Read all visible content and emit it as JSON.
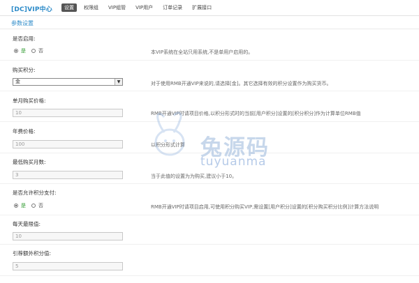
{
  "brand": "[DC]VIP中心",
  "nav": [
    "设置",
    "权限组",
    "VIP组管",
    "VIP用户",
    "订单记录",
    "扩展接口"
  ],
  "section_title": "参数设置",
  "fields": {
    "enable": {
      "label": "是否启用:",
      "opt_yes": "是",
      "opt_no": "否",
      "hint": "本VIP系统在全站只用系统,不是单用户启用的。"
    },
    "currency": {
      "label": "购买积分:",
      "value": "金",
      "hint": "对于使用RMB开通VIP来说的,请选择[金]。其它选择有效的积分设置作为购买货币。"
    },
    "monthly_price": {
      "label": "单月购买价格:",
      "value": "10",
      "hint": "RMB开通VIP时请项目价格,以积分形式时的当前[用户积分]设置的[积分积分]作为计算单位RMB值"
    },
    "yearly_price": {
      "label": "年费价格:",
      "value": "100",
      "hint": "以积分形式计算"
    },
    "min_months": {
      "label": "最低购买月数:",
      "value": "3",
      "hint": "当于此值的设置为为购买,建议小于10。"
    },
    "allow_points": {
      "label": "是否允许积分支付:",
      "opt_yes": "是",
      "opt_no": "否",
      "hint": "RMB开通VIP时请项目启用,可使用积分购买VIP,需设置[用户积分]设置的[积分购买积分比例]计算方法说明"
    },
    "daily_limit": {
      "label": "每天最限值:",
      "value": "10"
    },
    "extra_credit": {
      "label": "引荐额外积分值:",
      "value": "5"
    }
  },
  "watermark": {
    "title": "兔源码",
    "subtitle": "tuyuanma"
  },
  "colors": {
    "brand": "#2b8ac8",
    "active_tab": "#555555",
    "yes": "#2e9a2e"
  }
}
